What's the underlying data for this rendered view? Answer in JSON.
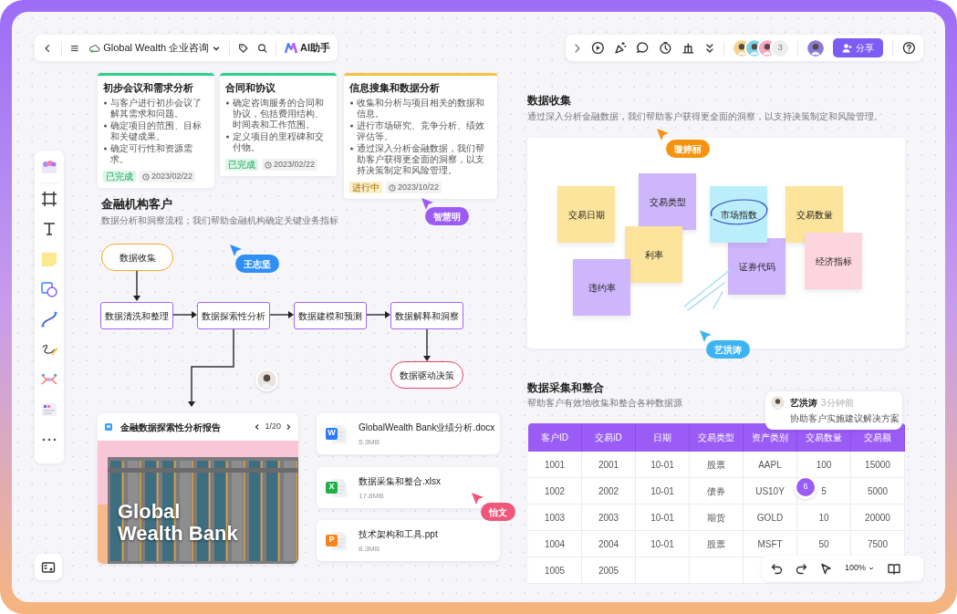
{
  "top_bar": {
    "document_title": "Global Wealth 企业咨询",
    "ai_label": "AI助手",
    "extra_collaborators": "3",
    "share_button": "分享"
  },
  "task_cards": [
    {
      "title": "初步会议和需求分析",
      "bullets": [
        "与客户进行初步会议了解其需求和问题。",
        "确定项目的范围、目标和关键成果。",
        "确定可行性和资源需求。"
      ],
      "status": "已完成",
      "kind": "done",
      "date": "2023/02/22"
    },
    {
      "title": "合同和协议",
      "bullets": [
        "确定咨询服务的合同和协议，包括费用结构、时间表和工作范围。",
        "定义项目的里程碑和交付物。"
      ],
      "status": "已完成",
      "kind": "done",
      "date": "2023/02/22"
    },
    {
      "title": "信息搜集和数据分析",
      "bullets": [
        "收集和分析与项目相关的数据和信息。",
        "进行市场研究、竞争分析、绩效评估等。",
        "通过深入分析金融数据，我们帮助客户获得更全面的洞察，以支持决策制定和风险管理。"
      ],
      "status": "进行中",
      "kind": "in_progress",
      "date": "2023/10/22"
    }
  ],
  "flow_section": {
    "title": "金融机构客户",
    "subtitle": "数据分析和洞察流程；我们帮助金融机构确定关键业务指标"
  },
  "flowchart": {
    "nodes": [
      {
        "label": "数据收集",
        "kind": "start"
      },
      {
        "label": "数据清洗和整理",
        "kind": "process"
      },
      {
        "label": "数据探索性分析",
        "kind": "process"
      },
      {
        "label": "数据建模和预测",
        "kind": "process"
      },
      {
        "label": "数据解释和洞察",
        "kind": "process"
      },
      {
        "label": "数据驱动决策",
        "kind": "end"
      }
    ]
  },
  "report": {
    "title": "金融数据探索性分析报告",
    "page": "1/20",
    "cover_lines": [
      "Global",
      "Wealth Bank"
    ]
  },
  "files": [
    {
      "name": "GlobalWealth Bank业绩分析.docx",
      "size": "5.3MB",
      "kind": "word",
      "badge": "W"
    },
    {
      "name": "数据采集和整合.xlsx",
      "size": "17.8MB",
      "kind": "excel",
      "badge": "X"
    },
    {
      "name": "技术架构和工具.ppt",
      "size": "8.3MB",
      "kind": "ppt",
      "badge": "P"
    }
  ],
  "collection_section": {
    "title": "数据收集",
    "subtitle": "通过深入分析金融数据，我们帮助客户获得更全面的洞察，以支持决策制定和风险管理。",
    "stickies": [
      {
        "label": "交易日期",
        "color": "#fde49c"
      },
      {
        "label": "交易类型",
        "color": "#cdb6fb"
      },
      {
        "label": "利率",
        "color": "#fde49c"
      },
      {
        "label": "违约率",
        "color": "#cdb6fb"
      },
      {
        "label": "市场指数",
        "color": "#b9eefa",
        "circled": true
      },
      {
        "label": "证券代码",
        "color": "#cdb6fb"
      },
      {
        "label": "交易数量",
        "color": "#fde49c"
      },
      {
        "label": "经济指标",
        "color": "#fcd5de"
      }
    ]
  },
  "table_section": {
    "title": "数据采集和整合",
    "subtitle": "帮助客户有效地收集和整合各种数据源",
    "columns": [
      "客户ID",
      "交易iD",
      "日期",
      "交易类型",
      "资产类别",
      "交易数量",
      "交易额"
    ],
    "rows": [
      [
        "1001",
        "2001",
        "10-01",
        "股票",
        "AAPL",
        "100",
        "15000"
      ],
      [
        "1002",
        "2002",
        "10-01",
        "债券",
        "US10Y",
        "5",
        "5000"
      ],
      [
        "1003",
        "2003",
        "10-01",
        "期货",
        "GOLD",
        "10",
        "20000"
      ],
      [
        "1004",
        "2004",
        "10-01",
        "股票",
        "MSFT",
        "50",
        "7500"
      ],
      [
        "1005",
        "2005"
      ]
    ]
  },
  "comment": {
    "author": "艺洪涛",
    "time": "3分钟前",
    "text": "协助客户实施建议解决方案"
  },
  "count_badge": "6",
  "cursors": [
    {
      "name": "智慧明",
      "color": "#9b5cf6"
    },
    {
      "name": "王志坚",
      "color": "#2f8ff5"
    },
    {
      "name": "璇婷丽",
      "color": "#f7920f"
    },
    {
      "name": "艺洪涛",
      "color": "#3db4f2"
    },
    {
      "name": "怡文",
      "color": "#f0567a"
    }
  ],
  "zoom_level": "100%"
}
